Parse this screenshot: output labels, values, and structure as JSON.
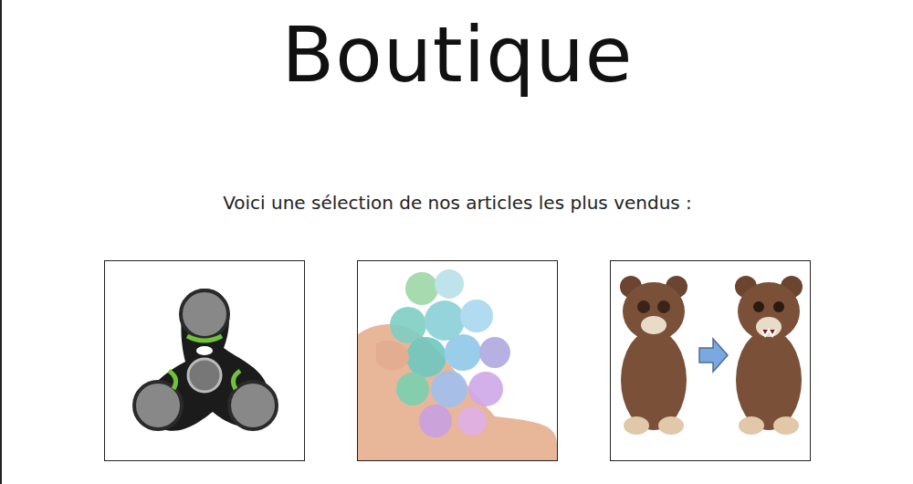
{
  "page": {
    "title": "Boutique",
    "intro": "Voici une sélection de nos articles les plus vendus :"
  },
  "products": [
    {
      "kind": "spinner"
    },
    {
      "kind": "stress-ball"
    },
    {
      "kind": "bear"
    }
  ]
}
